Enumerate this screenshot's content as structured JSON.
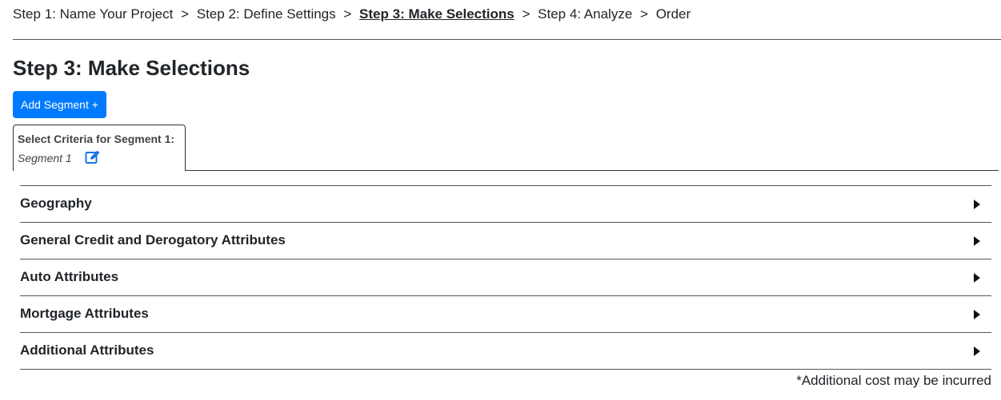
{
  "breadcrumb": {
    "separator": ">",
    "steps": [
      {
        "label": "Step 1: Name Your Project",
        "active": false
      },
      {
        "label": "Step 2: Define Settings",
        "active": false
      },
      {
        "label": "Step 3: Make Selections",
        "active": true
      },
      {
        "label": "Step 4: Analyze",
        "active": false
      },
      {
        "label": "Order",
        "active": false
      }
    ]
  },
  "page": {
    "title": "Step 3: Make Selections"
  },
  "actions": {
    "add_segment_label": "Add Segment +"
  },
  "segment_tab": {
    "title": "Select Criteria for Segment 1:",
    "name": "Segment 1",
    "edit_icon": "edit-icon"
  },
  "accordion": {
    "items": [
      {
        "label": "Geography",
        "icon": "caret-right-icon"
      },
      {
        "label": "General Credit and Derogatory Attributes",
        "icon": "caret-right-icon"
      },
      {
        "label": "Auto Attributes",
        "icon": "caret-right-icon"
      },
      {
        "label": "Mortgage Attributes",
        "icon": "caret-right-icon"
      },
      {
        "label": "Additional Attributes",
        "icon": "caret-right-icon"
      }
    ]
  },
  "footnote": "*Additional cost may be incurred",
  "colors": {
    "primary": "#007bff",
    "text": "#212529"
  }
}
